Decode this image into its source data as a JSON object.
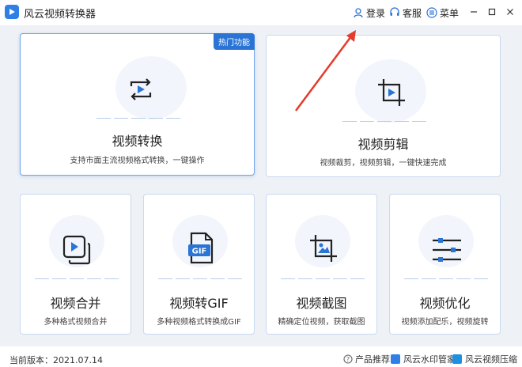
{
  "app": {
    "title": "风云视频转换器",
    "login_label": "登录",
    "service_label": "客服",
    "menu_label": "菜单"
  },
  "colors": {
    "accent": "#2a74d6",
    "card_border": "#c9d9f0",
    "background": "#eef1f6"
  },
  "cards": {
    "convert": {
      "badge": "热门功能",
      "title": "视频转换",
      "desc": "支持市面主流视频格式转换，一键操作",
      "icon": "convert-loop-play-icon"
    },
    "edit": {
      "title": "视频剪辑",
      "desc": "视频裁剪，视频剪辑，一键快速完成",
      "icon": "crop-play-icon"
    },
    "merge": {
      "title": "视频合并",
      "desc": "多种格式视频合并",
      "icon": "stacked-play-icon"
    },
    "gif": {
      "title": "视频转GIF",
      "desc": "多种视频格式转换成GIF",
      "icon": "gif-file-icon",
      "icon_text": "GIF"
    },
    "capture": {
      "title": "视频截图",
      "desc": "精确定位视频，获取截图",
      "icon": "crop-image-icon"
    },
    "optimize": {
      "title": "视频优化",
      "desc": "视频添加配乐，视频旋转",
      "icon": "sliders-icon"
    }
  },
  "status": {
    "version": "当前版本：2021.07.14",
    "recommend_label": "产品推荐：",
    "product1": "风云水印管家",
    "product2": "风云视频压缩"
  }
}
